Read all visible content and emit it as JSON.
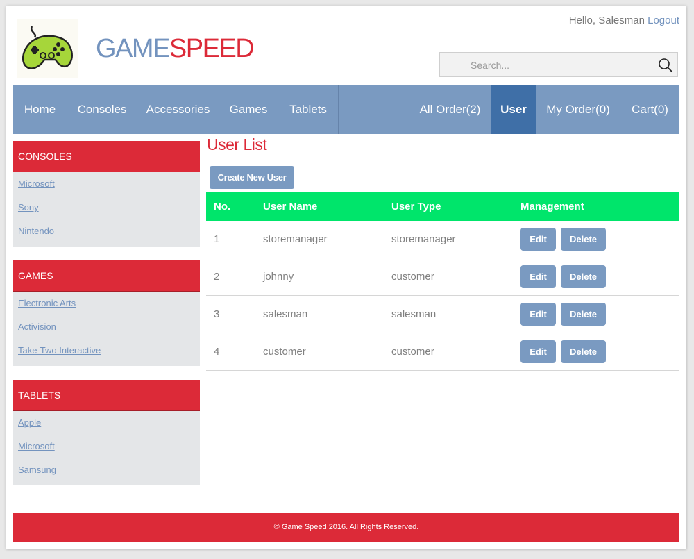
{
  "header": {
    "brand_part1": "GAME",
    "brand_part2": "SPEED",
    "greeting": "Hello, Salesman",
    "logout_label": "Logout",
    "logo_icon": "gamepad-icon",
    "search": {
      "placeholder": "Search...",
      "value": "",
      "icon": "search-icon"
    }
  },
  "nav": {
    "items": [
      {
        "label": "Home"
      },
      {
        "label": "Consoles"
      },
      {
        "label": "Accessories"
      },
      {
        "label": "Games"
      },
      {
        "label": "Tablets"
      },
      {
        "label": "All Order(2)"
      },
      {
        "label": "User",
        "active": true
      },
      {
        "label": "My Order(0)"
      },
      {
        "label": "Cart(0)"
      }
    ]
  },
  "sidebar": {
    "sections": [
      {
        "title": "CONSOLES",
        "links": [
          "Microsoft",
          "Sony",
          "Nintendo"
        ]
      },
      {
        "title": "GAMES",
        "links": [
          "Electronic Arts",
          "Activision",
          "Take-Two Interactive"
        ]
      },
      {
        "title": "TABLETS",
        "links": [
          "Apple",
          "Microsoft",
          "Samsung"
        ]
      }
    ]
  },
  "main": {
    "title": "User List",
    "create_button": "Create New User",
    "table": {
      "headers": [
        "No.",
        "User Name",
        "User Type",
        "Management"
      ],
      "edit_label": "Edit",
      "delete_label": "Delete",
      "rows": [
        {
          "no": "1",
          "name": "storemanager",
          "type": "storemanager"
        },
        {
          "no": "2",
          "name": "johnny",
          "type": "customer"
        },
        {
          "no": "3",
          "name": "salesman",
          "type": "salesman"
        },
        {
          "no": "4",
          "name": "customer",
          "type": "customer"
        }
      ]
    }
  },
  "footer": {
    "text": "© Game Speed 2016. All Rights Reserved."
  },
  "colors": {
    "brand_blue": "#7393be",
    "brand_red": "#dc2a38",
    "nav_bg": "#7a9ac1",
    "nav_active": "#3f6fa7",
    "table_header": "#00e56b"
  }
}
